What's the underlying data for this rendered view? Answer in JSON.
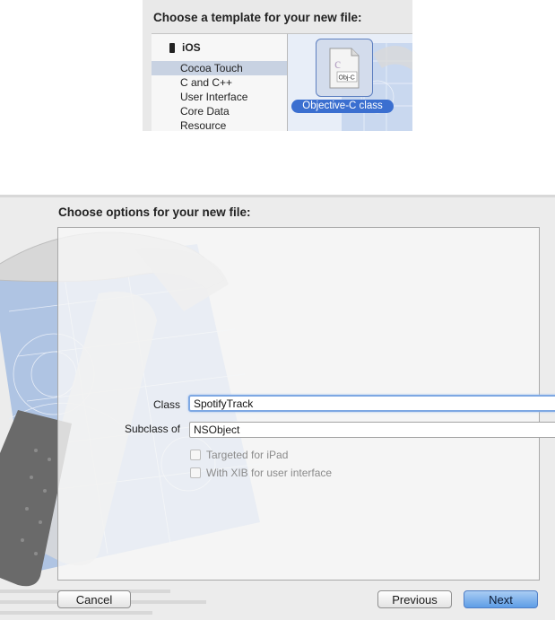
{
  "template_chooser": {
    "title": "Choose a template for your new file:",
    "platform_label": "iOS",
    "categories": [
      {
        "label": "Cocoa Touch",
        "selected": true
      },
      {
        "label": "C and C++",
        "selected": false
      },
      {
        "label": "User Interface",
        "selected": false
      },
      {
        "label": "Core Data",
        "selected": false
      },
      {
        "label": "Resource",
        "selected": false
      }
    ],
    "selected_template": {
      "icon": "objc-file-icon",
      "icon_text": "Obj-C",
      "label": "Objective-C class"
    }
  },
  "options_sheet": {
    "title": "Choose options for your new file:",
    "class_label": "Class",
    "class_value": "SpotifyTrack",
    "subclass_label": "Subclass of",
    "subclass_value": "NSObject",
    "checkbox_ipad_label": "Targeted for iPad",
    "checkbox_xib_label": "With XIB for user interface",
    "checkbox_ipad_checked": false,
    "checkbox_xib_checked": false
  },
  "buttons": {
    "cancel": "Cancel",
    "previous": "Previous",
    "next": "Next"
  },
  "colors": {
    "selection_highlight": "#3b6fd0",
    "primary_button": "#5e9de6",
    "focus_ring": "#7ea8e3"
  }
}
